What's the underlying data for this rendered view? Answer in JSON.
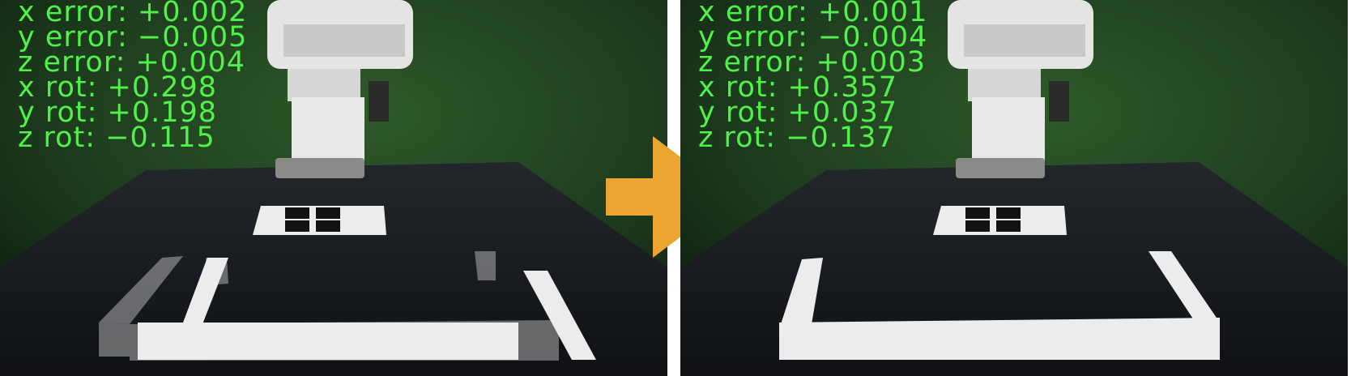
{
  "colors": {
    "overlay_text": "#52f04b",
    "arrow": "#eda531",
    "divider": "#ffffff"
  },
  "panels": [
    {
      "state": "before",
      "readouts": [
        {
          "label": "x error:",
          "value": "+0.002"
        },
        {
          "label": "y error:",
          "value": "−0.005"
        },
        {
          "label": "z error:",
          "value": "+0.004"
        },
        {
          "label": "x rot:",
          "value": "+0.298"
        },
        {
          "label": "y rot:",
          "value": "+0.198"
        },
        {
          "label": "z rot:",
          "value": "−0.115"
        }
      ]
    },
    {
      "state": "after",
      "readouts": [
        {
          "label": "x error:",
          "value": "+0.001"
        },
        {
          "label": "y error:",
          "value": "−0.004"
        },
        {
          "label": "z error:",
          "value": "+0.003"
        },
        {
          "label": "x rot:",
          "value": "+0.357"
        },
        {
          "label": "y rot:",
          "value": "+0.037"
        },
        {
          "label": "z rot:",
          "value": "−0.137"
        }
      ]
    }
  ],
  "arrow_icon": "right-arrow-icon"
}
